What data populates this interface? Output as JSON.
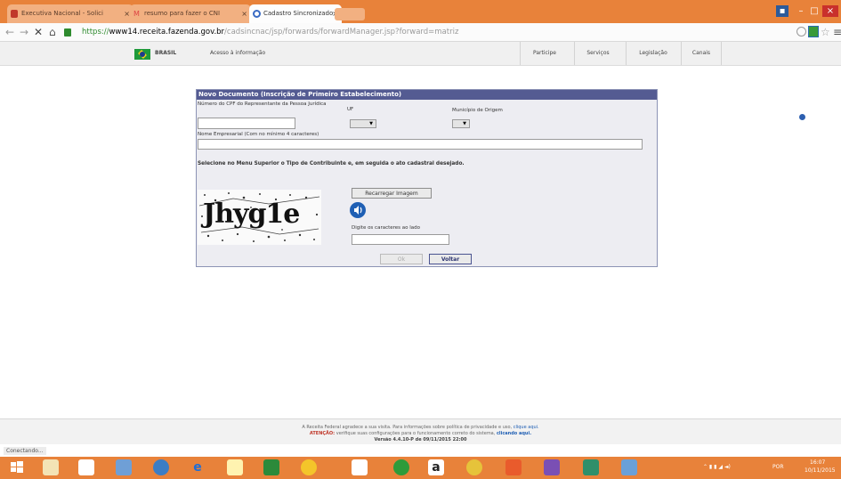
{
  "browser": {
    "tabs": [
      {
        "title": "Executiva Nacional - Solici",
        "active": false
      },
      {
        "title": "resumo para fazer o CNI",
        "active": false
      },
      {
        "title": "Cadastro Sincronizado N",
        "active": true
      }
    ],
    "tab_close_glyph": "×",
    "address": {
      "scheme": "https://",
      "host": "www14.receita.fazenda.gov.br",
      "path": "/cadsincnac/jsp/forwards/forwardManager.jsp?forward=matriz"
    }
  },
  "site_header": {
    "country_label": "BRASIL",
    "access_label": "Acesso à informação",
    "nav": [
      "Participe",
      "Serviços",
      "Legislação",
      "Canais"
    ]
  },
  "form": {
    "title": "Novo Documento (Inscrição de Primeiro Estabelecimento)",
    "cpf_label": "Número do CPF do Representante da Pessoa Jurídica",
    "cpf_value": "",
    "uf_label": "UF",
    "uf_value": "",
    "municipio_label": "Município de Origem",
    "municipio_value": "",
    "nome_label": "Nome Empresarial  (Com no mínimo 4 caracteres)",
    "nome_value": "",
    "instruction": "Selecione no Menu Superior o Tipo de Contribuinte e, em seguida o ato cadastral desejado.",
    "captcha_text": "Jhyg1e",
    "reload_label": "Recarregar Imagem",
    "captcha_prompt": "Digite os caracteres ao lado",
    "captcha_value": "",
    "ok_label": "Ok",
    "back_label": "Voltar"
  },
  "footer": {
    "line1": "A Receita Federal agradece a sua visita. Para informações sobre política de privacidade e uso,",
    "line1_link": "clique aqui.",
    "line2_strong": "ATENÇÃO:",
    "line2": "verifique suas configurações para o funcionamento correto do sistema,",
    "line2_link": "clicando aqui.",
    "version": "Versão 4.4.10-P de 09/11/2015 22:00"
  },
  "status_text": "Conectando...",
  "taskbar": {
    "language": "POR",
    "time": "16:07",
    "date": "10/11/2015"
  },
  "colors": {
    "tab_bar": "#e8823a",
    "panel_header": "#545b92",
    "url_secure": "#2e8b2e",
    "link_blue": "#1f5fb4"
  }
}
